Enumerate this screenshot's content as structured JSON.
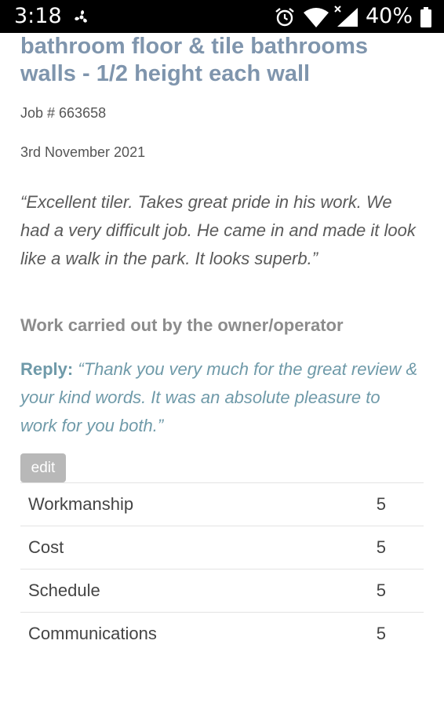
{
  "status_bar": {
    "time": "3:18",
    "battery": "40%"
  },
  "review": {
    "title": "bathroom floor & tile bathrooms walls - 1/2 height each wall",
    "job_number": "Job # 663658",
    "date": "3rd November 2021",
    "quote": "“Excellent tiler. Takes great pride in his work. We had a very difficult job. He came in and made it look like a walk in the park. It looks superb.”",
    "work_by": "Work carried out by the owner/operator",
    "reply_label": "Reply:",
    "reply_text": "“Thank you very much for the great review & your kind words. It was an absolute pleasure to work for you both.”",
    "edit_label": "edit"
  },
  "ratings": [
    {
      "label": "Workmanship",
      "value": "5"
    },
    {
      "label": "Cost",
      "value": "5"
    },
    {
      "label": "Schedule",
      "value": "5"
    },
    {
      "label": "Communications",
      "value": "5"
    }
  ],
  "colors": {
    "title": "#7f95ad",
    "reply": "#6f9aa9",
    "edit_bg": "#b8b8b8"
  },
  "icons": [
    "fan-icon",
    "alarm-icon",
    "wifi-icon",
    "signal-icon",
    "battery-icon"
  ]
}
